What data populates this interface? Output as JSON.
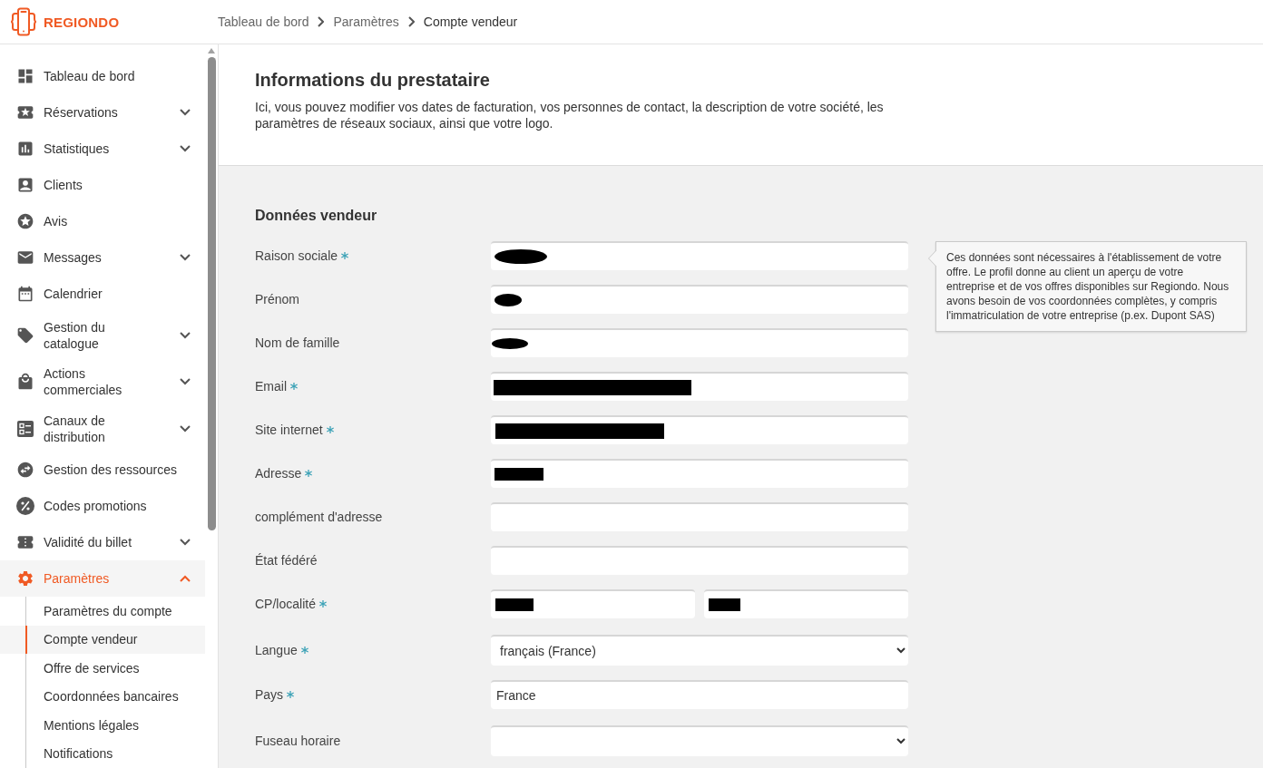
{
  "header": {
    "brand": "REGIONDO",
    "breadcrumb": [
      {
        "label": "Tableau de bord",
        "current": false
      },
      {
        "label": "Paramètres",
        "current": false
      },
      {
        "label": "Compte vendeur",
        "current": true
      }
    ]
  },
  "sidebar": {
    "items": [
      {
        "label": "Tableau de bord",
        "kind": "link",
        "selected": false
      },
      {
        "label": "Réservations",
        "kind": "group",
        "expanded": false,
        "selected": false
      },
      {
        "label": "Statistiques",
        "kind": "group",
        "expanded": false,
        "selected": false
      },
      {
        "label": "Clients",
        "kind": "link",
        "selected": false
      },
      {
        "label": "Avis",
        "kind": "link",
        "selected": false
      },
      {
        "label": "Messages",
        "kind": "group",
        "expanded": false,
        "selected": false
      },
      {
        "label": "Calendrier",
        "kind": "link",
        "selected": false
      },
      {
        "label": "Gestion du catalogue",
        "kind": "group",
        "expanded": false,
        "selected": false
      },
      {
        "label": "Actions commerciales",
        "kind": "group",
        "expanded": false,
        "selected": false
      },
      {
        "label": "Canaux de distribution",
        "kind": "group",
        "expanded": false,
        "selected": false
      },
      {
        "label": "Gestion des ressources",
        "kind": "link",
        "selected": false
      },
      {
        "label": "Codes promotions",
        "kind": "link",
        "selected": false
      },
      {
        "label": "Validité du billet",
        "kind": "group",
        "expanded": false,
        "selected": false
      },
      {
        "label": "Paramètres",
        "kind": "group",
        "expanded": true,
        "selected": true,
        "children": [
          {
            "label": "Paramètres du compte",
            "selected": false
          },
          {
            "label": "Compte vendeur",
            "selected": true
          },
          {
            "label": "Offre de services",
            "selected": false
          },
          {
            "label": "Coordonnées bancaires",
            "selected": false
          },
          {
            "label": "Mentions légales",
            "selected": false
          },
          {
            "label": "Notifications",
            "selected": false
          }
        ]
      }
    ]
  },
  "intro": {
    "title": "Informations du prestataire",
    "description": "Ici, vous pouvez modifier vos dates de facturation, vos personnes de contact, la description de votre société, les paramètres de réseaux sociaux, ainsi que votre logo."
  },
  "seller_form": {
    "title": "Données vendeur",
    "help": "Ces données sont nécessaires à l'établissement de votre offre. Le profil donne au client un aperçu de votre entreprise et de vos offres disponibles sur Regiondo. Nous avons besoin de vos coordonnées complètes, y compris l'immatriculation de votre entreprise (p.ex. Dupont SAS)",
    "fields": [
      {
        "label": "Raison sociale",
        "required": true,
        "kind": "text",
        "redacted": true
      },
      {
        "label": "Prénom",
        "required": false,
        "kind": "text",
        "redacted": true
      },
      {
        "label": "Nom de famille",
        "required": false,
        "kind": "text",
        "redacted": true
      },
      {
        "label": "Email",
        "required": true,
        "kind": "text",
        "redacted": true
      },
      {
        "label": "Site internet",
        "required": true,
        "kind": "text",
        "redacted": true
      },
      {
        "label": "Adresse",
        "required": true,
        "kind": "text",
        "redacted": true
      },
      {
        "label": "complément d'adresse",
        "required": false,
        "kind": "text",
        "redacted": false
      },
      {
        "label": "État fédéré",
        "required": false,
        "kind": "text",
        "redacted": false
      },
      {
        "label": "CP/localité",
        "required": true,
        "kind": "pair",
        "inputs": [
          {
            "redacted": true
          },
          {
            "redacted": true
          }
        ]
      },
      {
        "label": "Langue",
        "required": true,
        "kind": "select",
        "value": "français (France)"
      },
      {
        "label": "Pays",
        "required": true,
        "kind": "text",
        "value": "France",
        "redacted": false
      },
      {
        "label": "Fuseau horaire",
        "required": false,
        "kind": "select"
      }
    ]
  }
}
